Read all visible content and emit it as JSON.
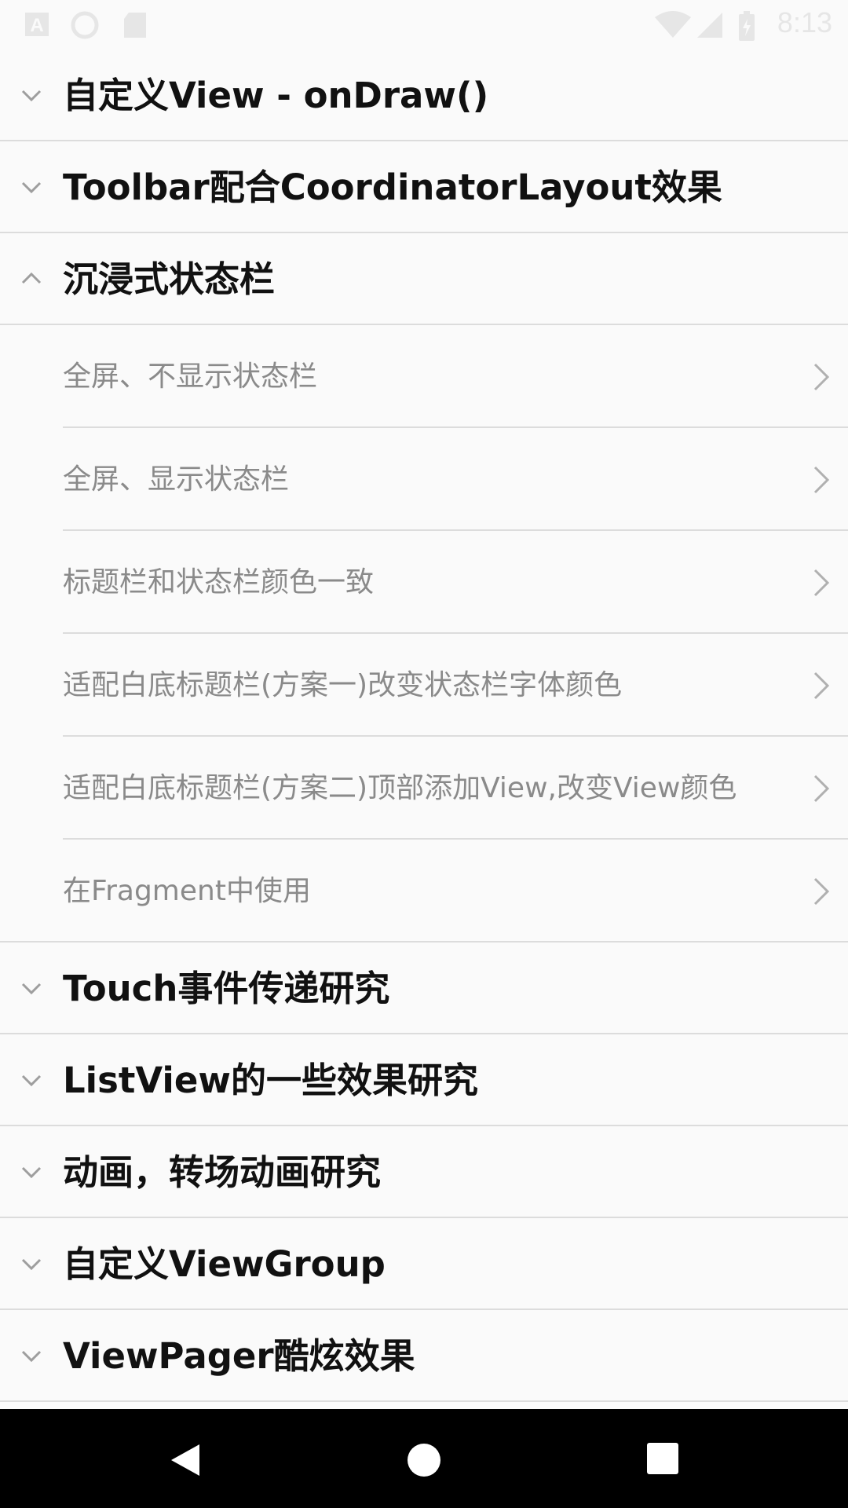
{
  "status_bar": {
    "time": "8:13",
    "icons": [
      "text-a-icon",
      "circle-icon",
      "sd-card-icon",
      "wifi-icon",
      "signal-icon",
      "battery-charging-icon"
    ]
  },
  "groups": [
    {
      "title": "自定义View - onDraw()",
      "expanded": false,
      "icon": "chevron-down-icon"
    },
    {
      "title": "Toolbar配合CoordinatorLayout效果",
      "expanded": false,
      "icon": "chevron-down-icon"
    },
    {
      "title": "沉浸式状态栏",
      "expanded": true,
      "icon": "chevron-up-icon",
      "children": [
        "全屏、不显示状态栏",
        "全屏、显示状态栏",
        "标题栏和状态栏颜色一致",
        "适配白底标题栏(方案一)改变状态栏字体颜色",
        "适配白底标题栏(方案二)顶部添加View,改变View颜色",
        "在Fragment中使用"
      ]
    },
    {
      "title": "Touch事件传递研究",
      "expanded": false,
      "icon": "chevron-down-icon"
    },
    {
      "title": "ListView的一些效果研究",
      "expanded": false,
      "icon": "chevron-down-icon"
    },
    {
      "title": "动画，转场动画研究",
      "expanded": false,
      "icon": "chevron-down-icon"
    },
    {
      "title": "自定义ViewGroup",
      "expanded": false,
      "icon": "chevron-down-icon"
    },
    {
      "title": "ViewPager酷炫效果",
      "expanded": false,
      "icon": "chevron-down-icon"
    }
  ],
  "nav_bar": {
    "buttons": [
      "back-icon",
      "home-icon",
      "recents-icon"
    ]
  },
  "colors": {
    "background": "#fafafa",
    "divider": "#dcdcdc",
    "group_title": "#111111",
    "child_label": "#8a8a8a",
    "chevron": "#9e9e9e",
    "nav_bar": "#000000"
  }
}
